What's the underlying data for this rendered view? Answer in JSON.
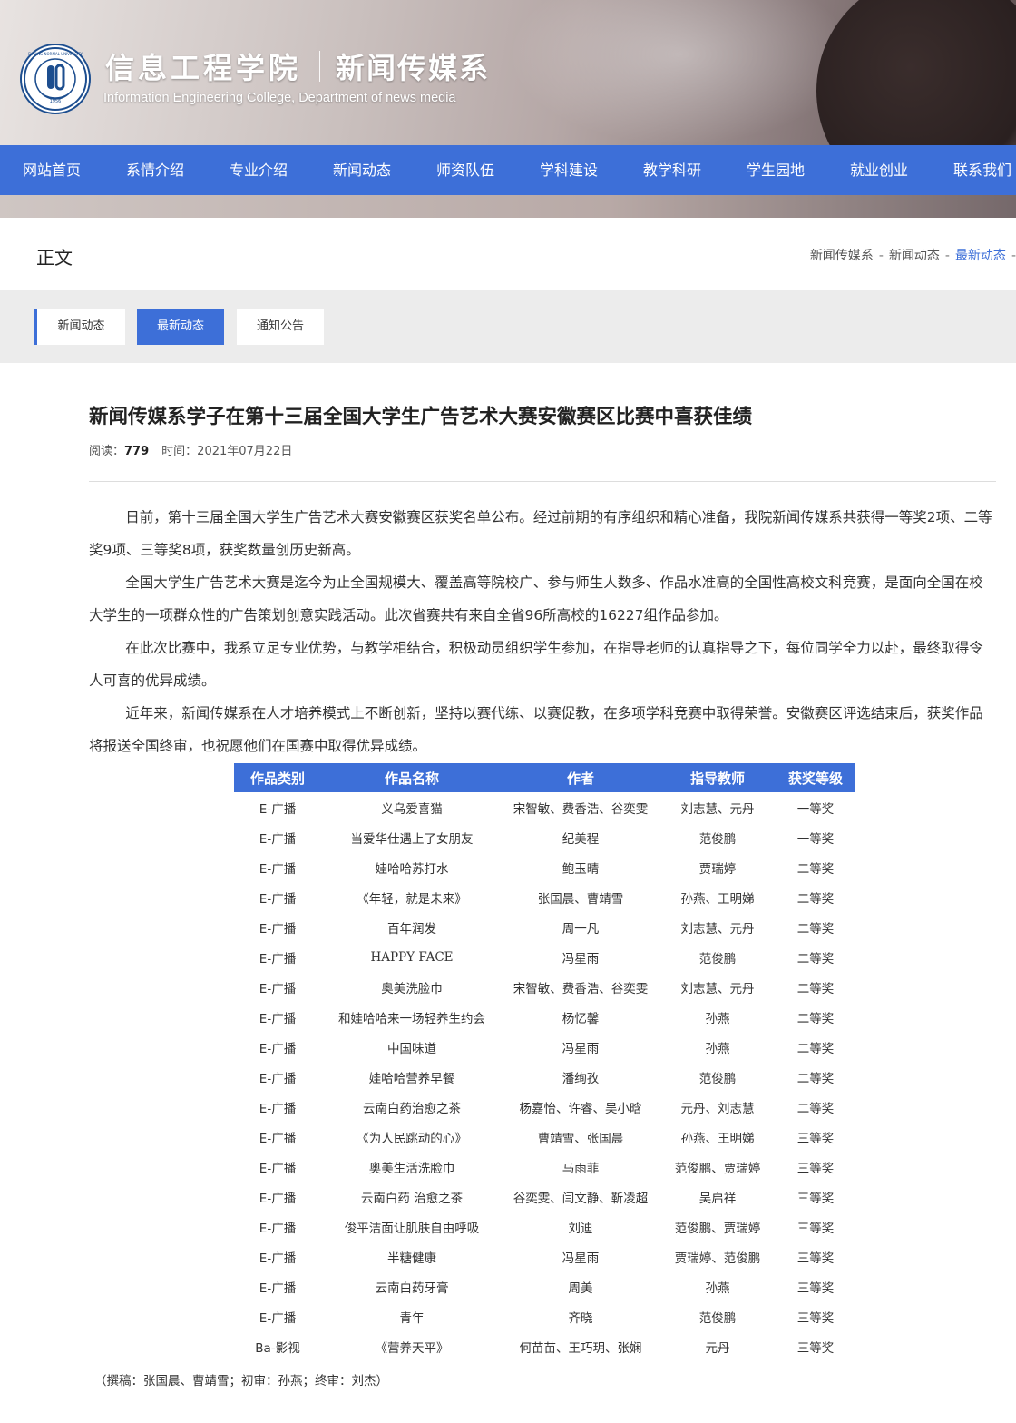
{
  "header": {
    "title": "信息工程学院",
    "department": "新闻传媒系",
    "english": "Information Engineering College,  Department of news media",
    "logo_text": "FUYANG NORMAL UNIVERSITY",
    "logo_year": "1956"
  },
  "nav": {
    "items": [
      "网站首页",
      "系情介绍",
      "专业介绍",
      "新闻动态",
      "师资队伍",
      "学科建设",
      "教学科研",
      "学生园地",
      "就业创业",
      "联系我们"
    ]
  },
  "page": {
    "section_title": "正文",
    "breadcrumb": [
      "新闻传媒系",
      "新闻动态",
      "最新动态"
    ],
    "breadcrumb_trailing_sep": "-"
  },
  "subtabs": [
    "新闻动态",
    "最新动态",
    "通知公告"
  ],
  "article": {
    "title": "新闻传媒系学子在第十三届全国大学生广告艺术大赛安徽赛区比赛中喜获佳绩",
    "reads_label": "阅读：",
    "reads": "779",
    "time_label": "时间：",
    "time": "2021年07月22日",
    "paragraphs": [
      "日前，第十三届全国大学生广告艺术大赛安徽赛区获奖名单公布。经过前期的有序组织和精心准备，我院新闻传媒系共获得一等奖2项、二等奖9项、三等奖8项，获奖数量创历史新高。",
      "全国大学生广告艺术大赛是迄今为止全国规模大、覆盖高等院校广、参与师生人数多、作品水准高的全国性高校文科竞赛，是面向全国在校大学生的一项群众性的广告策划创意实践活动。此次省赛共有来自全省96所高校的16227组作品参加。",
      "在此次比赛中，我系立足专业优势，与教学相结合，积极动员组织学生参加，在指导老师的认真指导之下，每位同学全力以赴，最终取得令人可喜的优异成绩。",
      "近年来，新闻传媒系在人才培养模式上不断创新，坚持以赛代练、以赛促教，在多项学科竞赛中取得荣誉。安徽赛区评选结束后，获奖作品将报送全国终审，也祝愿他们在国赛中取得优异成绩。"
    ],
    "table": {
      "headers": [
        "作品类别",
        "作品名称",
        "作者",
        "指导教师",
        "获奖等级"
      ],
      "rows": [
        [
          "E-广播",
          "义乌爱喜猫",
          "宋智敏、费香浩、谷奕雯",
          "刘志慧、元丹",
          "一等奖"
        ],
        [
          "E-广播",
          "当爱华仕遇上了女朋友",
          "纪美程",
          "范俊鹏",
          "一等奖"
        ],
        [
          "E-广播",
          "娃哈哈苏打水",
          "鲍玉晴",
          "贾瑞婷",
          "二等奖"
        ],
        [
          "E-广播",
          "《年轻，就是未来》",
          "张国晨、曹靖雪",
          "孙燕、王明娣",
          "二等奖"
        ],
        [
          "E-广播",
          "百年润发",
          "周一凡",
          "刘志慧、元丹",
          "二等奖"
        ],
        [
          "E-广播",
          "HAPPY FACE",
          "冯星雨",
          "范俊鹏",
          "二等奖"
        ],
        [
          "E-广播",
          "奥美洗脸巾",
          "宋智敏、费香浩、谷奕雯",
          "刘志慧、元丹",
          "二等奖"
        ],
        [
          "E-广播",
          "和娃哈哈来一场轻养生约会",
          "杨忆馨",
          "孙燕",
          "二等奖"
        ],
        [
          "E-广播",
          "中国味道",
          "冯星雨",
          "孙燕",
          "二等奖"
        ],
        [
          "E-广播",
          "娃哈哈营养早餐",
          "潘绚孜",
          "范俊鹏",
          "二等奖"
        ],
        [
          "E-广播",
          "云南白药治愈之茶",
          "杨嘉怡、许睿、吴小晗",
          "元丹、刘志慧",
          "二等奖"
        ],
        [
          "E-广播",
          "《为人民跳动的心》",
          "曹靖雪、张国晨",
          "孙燕、王明娣",
          "三等奖"
        ],
        [
          "E-广播",
          "奥美生活洗脸巾",
          "马雨菲",
          "范俊鹏、贾瑞婷",
          "三等奖"
        ],
        [
          "E-广播",
          "云南白药 治愈之茶",
          "谷奕雯、闫文静、靳凌超",
          "吴启祥",
          "三等奖"
        ],
        [
          "E-广播",
          "俊平洁面让肌肤自由呼吸",
          "刘迪",
          "范俊鹏、贾瑞婷",
          "三等奖"
        ],
        [
          "E-广播",
          "半糖健康",
          "冯星雨",
          "贾瑞婷、范俊鹏",
          "三等奖"
        ],
        [
          "E-广播",
          "云南白药牙膏",
          "周美",
          "孙燕",
          "三等奖"
        ],
        [
          "E-广播",
          "青年",
          "齐晓",
          "范俊鹏",
          "三等奖"
        ],
        [
          "Ba-影视",
          "《营养天平》",
          "何苗苗、王巧玥、张娴",
          "元丹",
          "三等奖"
        ]
      ]
    },
    "footnote": "（撰稿：张国晨、曹靖雪；初审：孙燕；终审：刘杰）"
  },
  "colors": {
    "accent": "#3d6fd8",
    "logo_blue": "#1d4e8f"
  }
}
